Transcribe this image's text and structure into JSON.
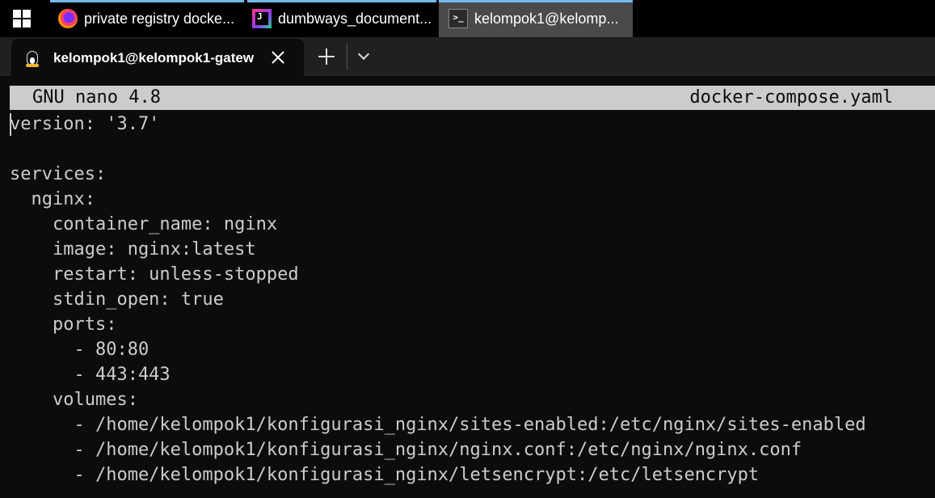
{
  "taskbar": {
    "items": [
      {
        "label": "private registry docke...",
        "icon": "firefox-icon"
      },
      {
        "label": "dumbways_document...",
        "icon": "jetbrains-icon"
      },
      {
        "label": "kelompok1@kelomp...",
        "icon": "terminal-icon",
        "active": true
      }
    ],
    "accent_color": "#76b9ed"
  },
  "terminal": {
    "tab_title": "kelompok1@kelompok1-gatew",
    "tab_icon": "linux-penguin-icon"
  },
  "nano": {
    "app": "GNU nano 4.8",
    "filename": "docker-compose.yaml",
    "lines": [
      "version: '3.7'",
      "",
      "services:",
      "  nginx:",
      "    container_name: nginx",
      "    image: nginx:latest",
      "    restart: unless-stopped",
      "    stdin_open: true",
      "    ports:",
      "      - 80:80",
      "      - 443:443",
      "    volumes:",
      "      - /home/kelompok1/konfigurasi_nginx/sites-enabled:/etc/nginx/sites-enabled",
      "      - /home/kelompok1/konfigurasi_nginx/nginx.conf:/etc/nginx/nginx.conf",
      "      - /home/kelompok1/konfigurasi_nginx/letsencrypt:/etc/letsencrypt"
    ]
  }
}
